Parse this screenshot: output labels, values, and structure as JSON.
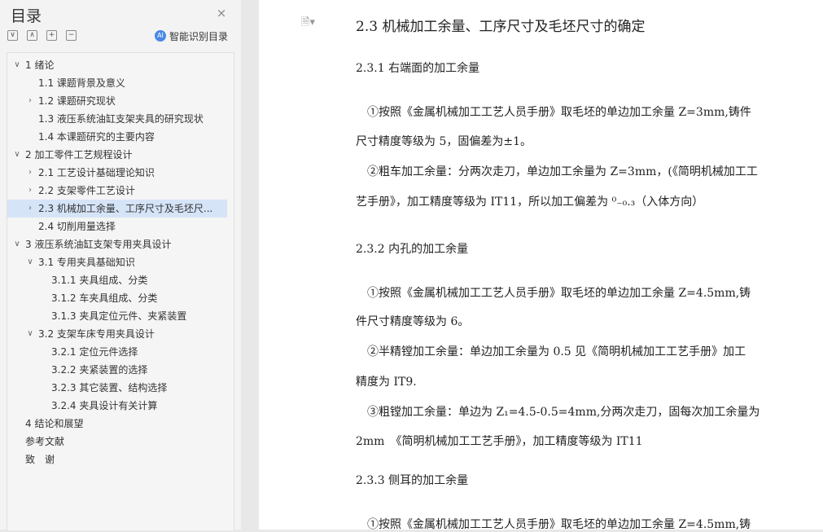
{
  "toc": {
    "title": "目录",
    "close": "×",
    "toolbar": [
      "∨",
      "∧",
      "+",
      "−"
    ],
    "smart_button": "智能识别目录",
    "ai_glyph": "AI",
    "items": [
      {
        "label": "1 绪论",
        "level": 1,
        "arrow": "∨"
      },
      {
        "label": "1.1 课题背景及意义",
        "level": 2,
        "arrow": ""
      },
      {
        "label": "1.2 课题研究现状",
        "level": 2,
        "arrow": "›"
      },
      {
        "label": "1.3 液压系统油缸支架夹具的研究现状",
        "level": 2,
        "arrow": ""
      },
      {
        "label": "1.4 本课题研究的主要内容",
        "level": 2,
        "arrow": ""
      },
      {
        "label": "2 加工零件工艺规程设计",
        "level": 1,
        "arrow": "∨"
      },
      {
        "label": "2.1 工艺设计基础理论知识",
        "level": 2,
        "arrow": "›"
      },
      {
        "label": "2.2 支架零件工艺设计",
        "level": 2,
        "arrow": "›"
      },
      {
        "label": "2.3 机械加工余量、工序尺寸及毛坯尺...",
        "level": 2,
        "arrow": "›",
        "active": true
      },
      {
        "label": "2.4 切削用量选择",
        "level": 2,
        "arrow": ""
      },
      {
        "label": "3 液压系统油缸支架专用夹具设计",
        "level": 1,
        "arrow": "∨"
      },
      {
        "label": "3.1 专用夹具基础知识",
        "level": 2,
        "arrow": "∨"
      },
      {
        "label": "3.1.1 夹具组成、分类",
        "level": 3,
        "arrow": ""
      },
      {
        "label": "3.1.2 车夹具组成、分类",
        "level": 3,
        "arrow": ""
      },
      {
        "label": "3.1.3 夹具定位元件、夹紧装置",
        "level": 3,
        "arrow": ""
      },
      {
        "label": "3.2 支架车床专用夹具设计",
        "level": 2,
        "arrow": "∨"
      },
      {
        "label": "3.2.1 定位元件选择",
        "level": 3,
        "arrow": ""
      },
      {
        "label": "3.2.2 夹紧装置的选择",
        "level": 3,
        "arrow": ""
      },
      {
        "label": "3.2.3 其它装置、结构选择",
        "level": 3,
        "arrow": ""
      },
      {
        "label": "3.2.4 夹具设计有关计算",
        "level": 3,
        "arrow": ""
      },
      {
        "label": "4 结论和展望",
        "level": 1,
        "arrow": ""
      },
      {
        "label": "参考文献",
        "level": 1,
        "arrow": ""
      },
      {
        "label": "致　谢",
        "level": 1,
        "arrow": ""
      }
    ]
  },
  "doc": {
    "icon": "🗎▾",
    "lines": [
      {
        "cls": "h2",
        "text": "2.3 机械加工余量、工序尺寸及毛坯尺寸的确定"
      },
      {
        "cls": "h3",
        "text": "2.3.1 右端面的加工余量"
      },
      {
        "cls": "p",
        "text": "　①按照《金属机械加工工艺人员手册》取毛坯的单边加工余量 Z=3mm,铸件"
      },
      {
        "cls": "p",
        "text": "尺寸精度等级为 5，固偏差为±1。"
      },
      {
        "cls": "p",
        "text": "　②粗车加工余量：分两次走刀，单边加工余量为 Z=3mm，(《简明机械加工工"
      },
      {
        "cls": "p",
        "text": "艺手册》，加工精度等级为 IT11，所以加工偏差为 ⁰₋₀.₃（入体方向）"
      },
      {
        "cls": "h3",
        "text": "2.3.2 内孔的加工余量"
      },
      {
        "cls": "p",
        "text": "　①按照《金属机械加工工艺人员手册》取毛坯的单边加工余量 Z=4.5mm,铸"
      },
      {
        "cls": "p",
        "text": "件尺寸精度等级为 6。"
      },
      {
        "cls": "p",
        "text": "　②半精镗加工余量：单边加工余量为 0.5 见《简明机械加工工艺手册》加工"
      },
      {
        "cls": "p",
        "text": "精度为 IT9."
      },
      {
        "cls": "p",
        "text": "　③粗镗加工余量：单边为 Z₁=4.5-0.5=4mm,分两次走刀，固每次加工余量为"
      },
      {
        "cls": "p",
        "text": "2mm　《简明机械加工工艺手册》，加工精度等级为 IT11"
      },
      {
        "cls": "h3",
        "text": "2.3.3 侧耳的加工余量"
      },
      {
        "cls": "p",
        "text": "　①按照《金属机械加工工艺人员手册》取毛坯的单边加工余量 Z=4.5mm,铸"
      }
    ]
  }
}
